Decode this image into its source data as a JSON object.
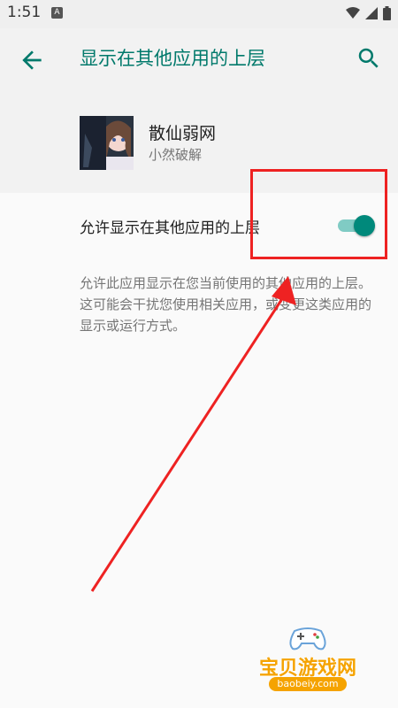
{
  "status_bar": {
    "time": "1:51",
    "notification_icon": "a-notification-icon",
    "wifi_icon": "wifi-icon",
    "signal_icon": "signal-icon",
    "battery_icon": "battery-icon"
  },
  "toolbar": {
    "back_icon": "arrow-back-icon",
    "title": "显示在其他应用的上层",
    "search_icon": "search-icon"
  },
  "app": {
    "name": "散仙弱网",
    "subtitle": "小然破解"
  },
  "setting": {
    "label": "允许显示在其他应用的上层",
    "enabled": true
  },
  "description": "允许此应用显示在您当前使用的其他应用的上层。这可能会干扰您使用相关应用，或变更这类应用的显示或运行方式。",
  "watermark": {
    "text": "宝贝游戏网",
    "url": "baobeiy.com"
  },
  "colors": {
    "accent": "#00796b",
    "switch_thumb": "#00897b",
    "switch_track": "#80cbc4",
    "annotation": "#ee2222",
    "watermark": "#f5a300"
  }
}
